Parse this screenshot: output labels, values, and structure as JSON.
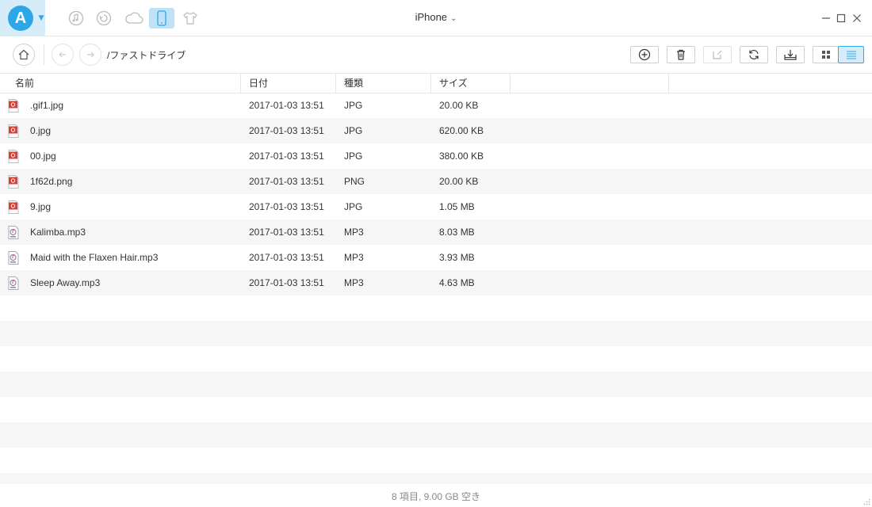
{
  "app": {
    "title": "iPhone",
    "logo_letter": "A",
    "nav_icons": [
      "music-icon",
      "history-icon",
      "cloud-icon",
      "phone-icon",
      "shirt-icon"
    ],
    "accent_color": "#2ea7e8"
  },
  "toolbar": {
    "path": "/ファストドライブ"
  },
  "table": {
    "columns": [
      "名前",
      "日付",
      "種類",
      "サイズ"
    ],
    "rows": [
      {
        "name": ".gif1.jpg",
        "date": "2017-01-03 13:51",
        "type": "JPG",
        "size": "20.00 KB",
        "icon": "image-file-icon"
      },
      {
        "name": "0.jpg",
        "date": "2017-01-03 13:51",
        "type": "JPG",
        "size": "620.00 KB",
        "icon": "image-file-icon"
      },
      {
        "name": "00.jpg",
        "date": "2017-01-03 13:51",
        "type": "JPG",
        "size": "380.00 KB",
        "icon": "image-file-icon"
      },
      {
        "name": "1f62d.png",
        "date": "2017-01-03 13:51",
        "type": "PNG",
        "size": "20.00 KB",
        "icon": "image-file-icon"
      },
      {
        "name": "9.jpg",
        "date": "2017-01-03 13:51",
        "type": "JPG",
        "size": "1.05 MB",
        "icon": "image-file-icon"
      },
      {
        "name": "Kalimba.mp3",
        "date": "2017-01-03 13:51",
        "type": "MP3",
        "size": "8.03 MB",
        "icon": "audio-file-icon"
      },
      {
        "name": "Maid with the Flaxen Hair.mp3",
        "date": "2017-01-03 13:51",
        "type": "MP3",
        "size": "3.93 MB",
        "icon": "audio-file-icon"
      },
      {
        "name": "Sleep Away.mp3",
        "date": "2017-01-03 13:51",
        "type": "MP3",
        "size": "4.63 MB",
        "icon": "audio-file-icon"
      }
    ]
  },
  "status": {
    "text": "8 項目, 9.00 GB 空き"
  }
}
